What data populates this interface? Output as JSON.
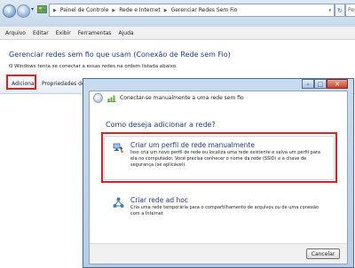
{
  "address_bar": {
    "breadcrumbs": [
      "Painel de Controle",
      "Rede e Internet",
      "Gerenciar Redes Sem Fio"
    ],
    "search_placeholder": "Pesquisar"
  },
  "menu": [
    "Arquivo",
    "Editar",
    "Exibir",
    "Ferramentas",
    "Ajuda"
  ],
  "main": {
    "title": "Gerenciar redes sem fio que usam (Conexão de Rede sem Fio)",
    "description": "O Windows tenta se conectar a essas redes na ordem listada abaixo."
  },
  "toolbar": {
    "add_label": "Adicionar",
    "properties_label": "Propriedades do a"
  },
  "dialog": {
    "title": "Conectar-se manualmente a uma rede sem fio",
    "question": "Como deseja adicionar a rede?",
    "options": [
      {
        "title": "Criar um perfil de rede manualmente",
        "description": "Isso cria um novo perfil de rede ou localiza uma rede existente e salva um perfil para ela no computador. Você precisa conhecer o nome da rede (SSID) e a chave de segurança (se aplicável).",
        "icon": "network-manual-icon"
      },
      {
        "title": "Criar rede ad hoc",
        "description": "Cria uma rede temporária para o compartilhamento de arquivos ou de uma conexão com a Internet",
        "icon": "network-adhoc-icon"
      }
    ],
    "cancel_label": "Cancelar"
  },
  "colors": {
    "accent_blue": "#1e3c87",
    "highlight_red": "#e02020"
  }
}
